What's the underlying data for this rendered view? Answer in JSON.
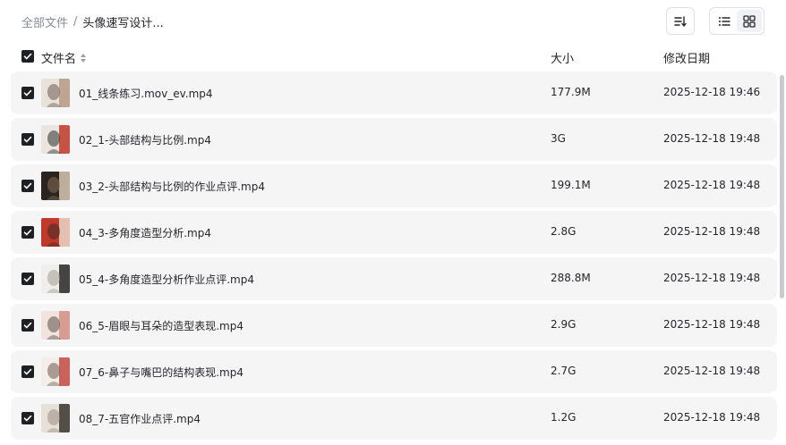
{
  "breadcrumb": {
    "root": "全部文件",
    "separator": "/",
    "current": "头像速写设计..."
  },
  "toolbar": {
    "sort_icon": "sort-list-icon",
    "view_list_icon": "list-view-icon",
    "view_grid_icon": "grid-view-icon",
    "active_view": "list"
  },
  "columns": {
    "name": "文件名",
    "size": "大小",
    "modified": "修改日期"
  },
  "files": [
    {
      "name": "01_线条练习.mov_ev.mp4",
      "size": "177.9M",
      "modified": "2025-12-18 19:46",
      "checked": true,
      "thumb_colors": [
        "#e8e2da",
        "#b69a86",
        "#6d5a4e"
      ]
    },
    {
      "name": "02_1-头部结构与比例.mp4",
      "size": "3G",
      "modified": "2025-12-18 19:48",
      "checked": true,
      "thumb_colors": [
        "#eae6df",
        "#c0392b",
        "#2b2b2b"
      ]
    },
    {
      "name": "03_2-头部结构与比例的作业点评.mp4",
      "size": "199.1M",
      "modified": "2025-12-18 19:48",
      "checked": true,
      "thumb_colors": [
        "#2a2420",
        "#d8c8b4",
        "#8a6e58"
      ]
    },
    {
      "name": "04_3-多角度造型分析.mp4",
      "size": "2.8G",
      "modified": "2025-12-18 19:48",
      "checked": true,
      "thumb_colors": [
        "#c0392b",
        "#e9d8c9",
        "#3d2b24"
      ]
    },
    {
      "name": "05_4-多角度造型分析作业点评.mp4",
      "size": "288.8M",
      "modified": "2025-12-18 19:48",
      "checked": true,
      "thumb_colors": [
        "#f1efec",
        "#262626",
        "#a39a90"
      ]
    },
    {
      "name": "06_5-眉眼与耳朵的造型表现.mp4",
      "size": "2.9G",
      "modified": "2025-12-18 19:48",
      "checked": true,
      "thumb_colors": [
        "#f1e4df",
        "#d28f87",
        "#5b4a44"
      ]
    },
    {
      "name": "07_6-鼻子与嘴巴的结构表现.mp4",
      "size": "2.7G",
      "modified": "2025-12-18 19:48",
      "checked": true,
      "thumb_colors": [
        "#f4eee9",
        "#c24a44",
        "#6e5a50"
      ]
    },
    {
      "name": "08_7-五官作业点评.mp4",
      "size": "1.2G",
      "modified": "2025-12-18 19:48",
      "checked": true,
      "thumb_colors": [
        "#e6e0d8",
        "#3a3430",
        "#9a8c80"
      ]
    }
  ],
  "colors": {
    "row_bg": "#f5f5f6",
    "checkbox": "#1f2024",
    "muted_text": "#878c9c"
  }
}
